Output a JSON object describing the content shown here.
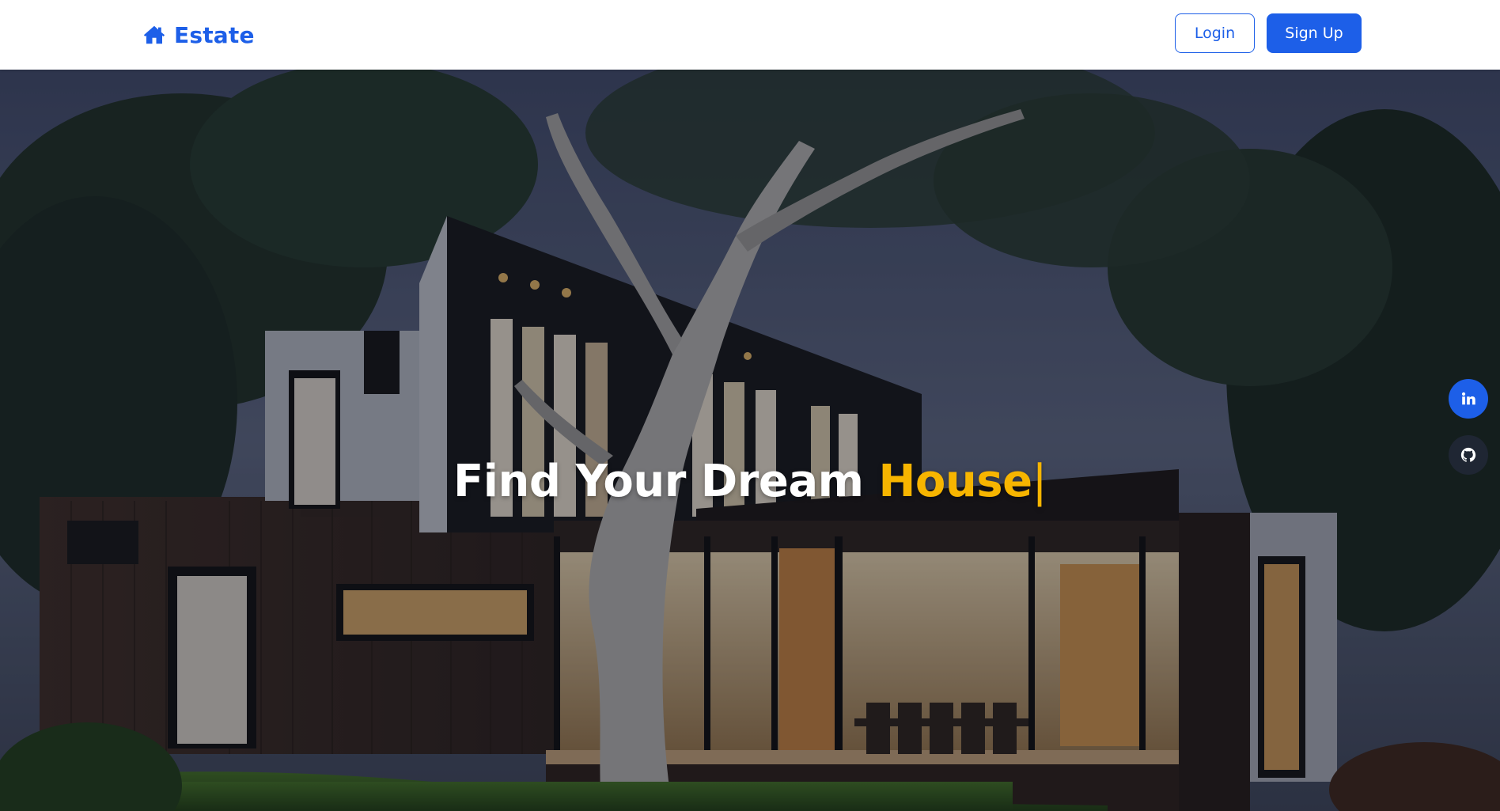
{
  "navbar": {
    "brand": {
      "icon": "home-icon",
      "text": "Estate",
      "color": "#1d5fe8"
    },
    "login_label": "Login",
    "signup_label": "Sign Up"
  },
  "hero": {
    "title_main": "Find Your Dream ",
    "title_highlight": "House",
    "cursor": "|",
    "highlight_color": "#f7b500",
    "background": "photo of modern house at dusk with large tree"
  },
  "social": {
    "linkedin": {
      "icon": "linkedin-icon",
      "color": "#1d5fe8"
    },
    "github": {
      "icon": "github-icon",
      "color": "#1f2633"
    }
  },
  "colors": {
    "primary": "#1d5fe8",
    "accent": "#f7b500"
  }
}
